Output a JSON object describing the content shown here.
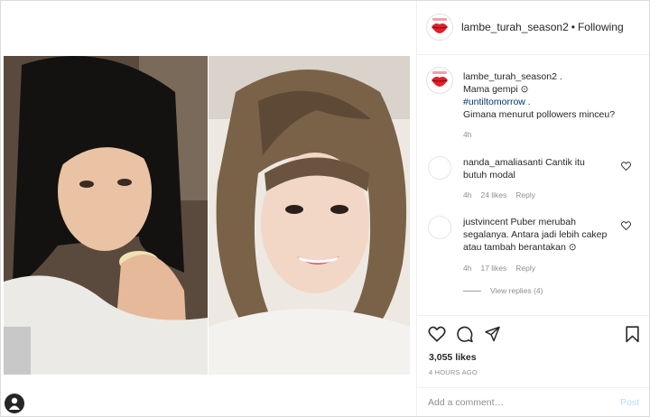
{
  "header": {
    "username": "lambe_turah_season2",
    "separator": "•",
    "follow_status": "Following",
    "avatar_icon": "red-lips-logo"
  },
  "caption": {
    "username": "lambe_turah_season2",
    "suffix": " .",
    "line1": "Mama gempi ⊙",
    "hashtag": "#untiltomorrow",
    "hashtag_suffix": " .",
    "line3": "Gimana menurut pollowers minceu?",
    "time": "4h"
  },
  "comments": [
    {
      "username": "nanda_amaliasanti",
      "text_line1": " Cantik itu",
      "text_line2": "butuh modal",
      "time": "4h",
      "likes": "24 likes",
      "reply": "Reply"
    },
    {
      "username": "justvincent",
      "text_line1": " Puber merubah",
      "text_line2": "segalanya. Antara jadi lebih cakep",
      "text_line3": "atau tambah berantakan ⊙",
      "time": "4h",
      "likes": "17 likes",
      "reply": "Reply"
    }
  ],
  "view_replies": "View replies (4)",
  "actions": {
    "likes": "3,055 likes",
    "time": "4 HOURS AGO"
  },
  "add_comment": {
    "placeholder": "Add a comment…",
    "post_label": "Post"
  },
  "colors": {
    "text": "#262626",
    "secondary": "#8e8e8e",
    "hashtag": "#00376b",
    "post_disabled": "#b2dffc",
    "logo_red": "#e0202a"
  }
}
